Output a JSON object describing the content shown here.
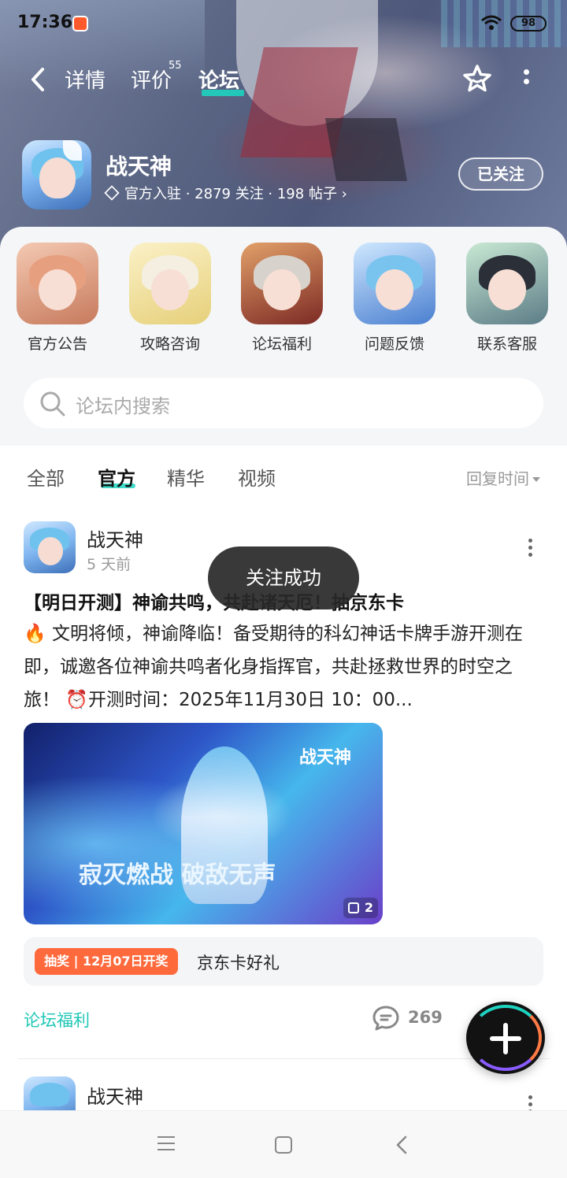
{
  "status_bar": {
    "time": "17:36",
    "battery": "98"
  },
  "header": {
    "tabs": {
      "detail": "详情",
      "review": "评价",
      "review_count": "55",
      "forum": "论坛"
    }
  },
  "game": {
    "name": "战天神",
    "meta": "官方入驻 · 2879 关注 · 198 帖子 ›",
    "follow_label": "已关注"
  },
  "shortcuts": [
    {
      "label": "官方公告"
    },
    {
      "label": "攻略咨询"
    },
    {
      "label": "论坛福利"
    },
    {
      "label": "问题反馈"
    },
    {
      "label": "联系客服"
    }
  ],
  "search": {
    "placeholder": "论坛内搜索"
  },
  "filters": {
    "all": "全部",
    "official": "官方",
    "featured": "精华",
    "video": "视频",
    "sort": "回复时间"
  },
  "post": {
    "author": "战天神",
    "time": "5 天前",
    "title": "【明日开测】神谕共鸣，共赴诸天厄！抽京东卡",
    "body": "🔥 文明将倾，神谕降临！备受期待的科幻神话卡牌手游开测在即，诚邀各位神谕共鸣者化身指挥官，共赴拯救世界的时空之旅！ ⏰开测时间：2025年11月30日 10：00...",
    "image_brand": "战天神",
    "image_slogan": "寂灭燃战 破敌无声",
    "image_count": "2",
    "lottery_tag": "抽奖 | 12月07日开奖",
    "lottery_prize": "京东卡好礼",
    "category": "论坛福利",
    "comment_count": "269"
  },
  "post2": {
    "author": "战天神"
  },
  "toast": "关注成功"
}
